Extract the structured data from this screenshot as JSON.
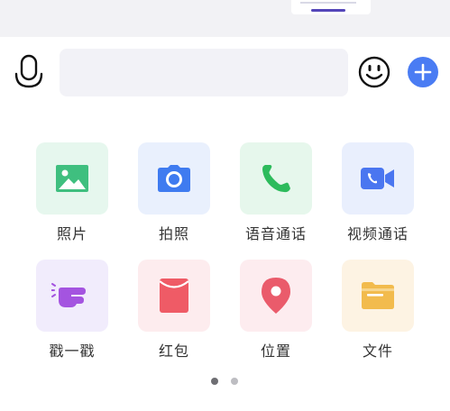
{
  "input": {
    "value": "",
    "placeholder": ""
  },
  "icons": {
    "voice": "microphone-icon",
    "emoji": "smiley-face-icon",
    "more": "plus-icon"
  },
  "colors": {
    "accent": "#4a7cf3",
    "photo": "#3fbf7f",
    "camera": "#3f7bf0",
    "voice_call": "#2dbb5c",
    "video_call": "#4a76f0",
    "poke": "#a454e0",
    "red_packet": "#ef5b66",
    "location": "#ea5b6b",
    "file": "#f2bb4d"
  },
  "panel": {
    "items": [
      {
        "label": "照片",
        "icon": "image-icon"
      },
      {
        "label": "拍照",
        "icon": "camera-icon"
      },
      {
        "label": "语音通话",
        "icon": "phone-icon"
      },
      {
        "label": "视频通话",
        "icon": "video-camera-icon"
      },
      {
        "label": "戳一戳",
        "icon": "poke-hand-icon"
      },
      {
        "label": "红包",
        "icon": "red-envelope-icon"
      },
      {
        "label": "位置",
        "icon": "location-pin-icon"
      },
      {
        "label": "文件",
        "icon": "folder-icon"
      }
    ]
  },
  "pager": {
    "total_pages": 2,
    "current_page": 1
  }
}
